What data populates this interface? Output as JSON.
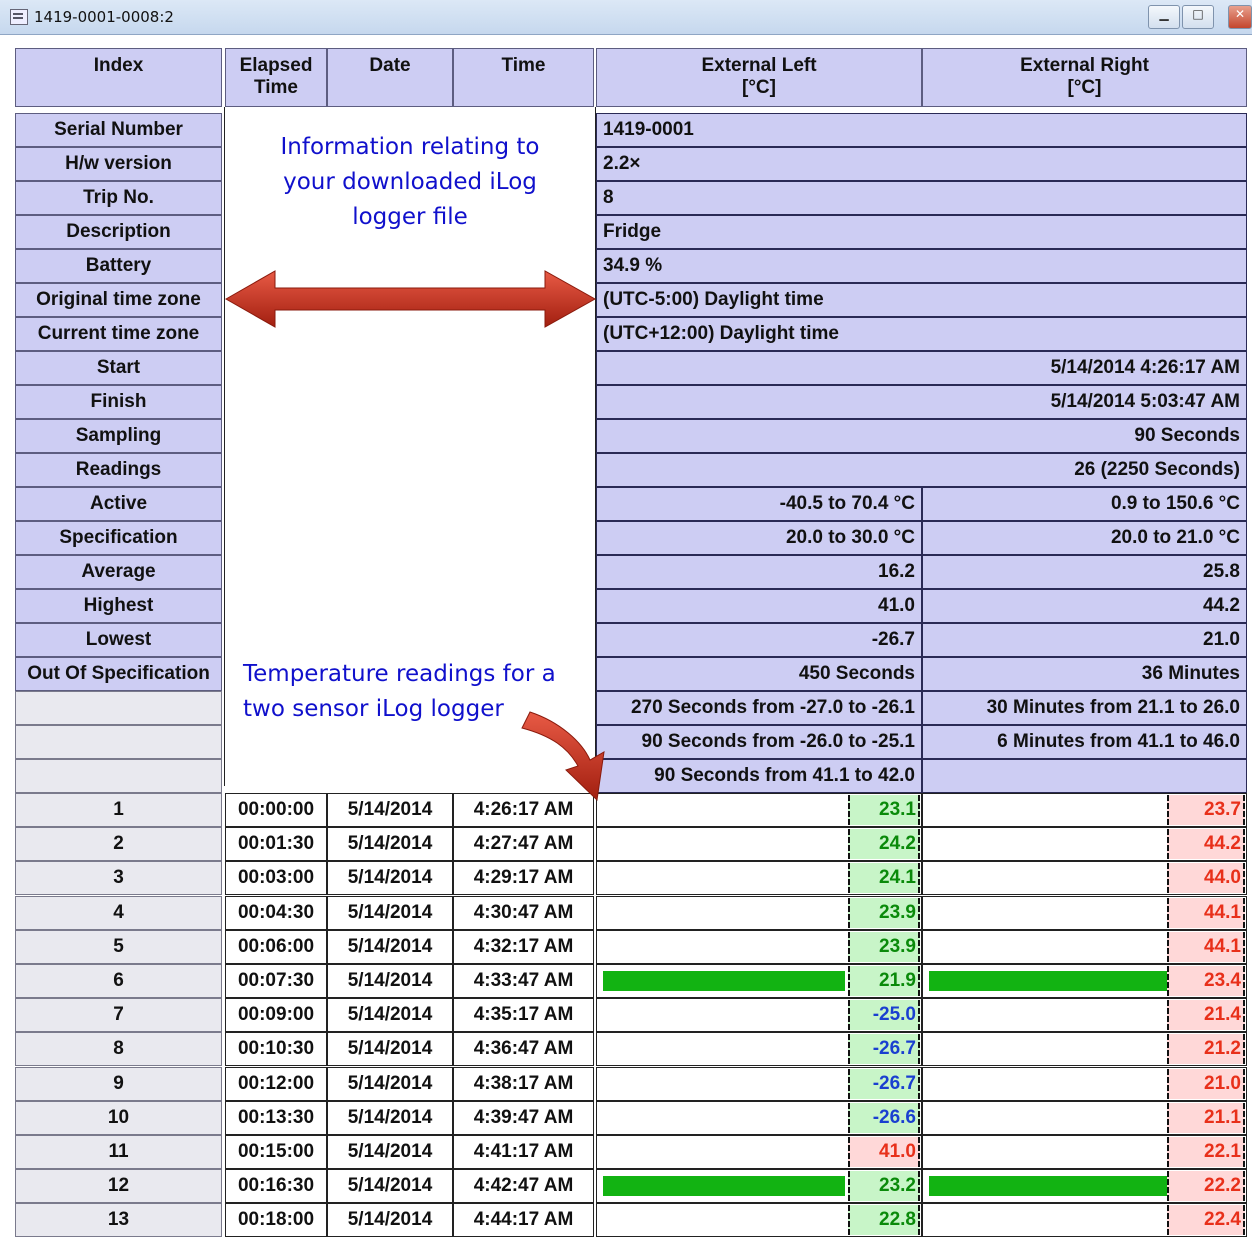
{
  "window": {
    "title": "1419-0001-0008:2"
  },
  "colors": {
    "header_bg": "#cdcdf3",
    "ok_green": "#12b312",
    "cell_green": "#c8f5c8",
    "cell_red": "#ffd8d8",
    "text_red": "#e8301a",
    "text_blue": "#1a3fd0",
    "text_green": "#0a8a0a",
    "note_blue": "#1010cc",
    "arrow_red": "#c8301d"
  },
  "headers": {
    "index": "Index",
    "elapsed_l1": "Elapsed",
    "elapsed_l2": "Time",
    "date": "Date",
    "time": "Time",
    "ext_left_l1": "External Left",
    "ext_left_l2": "[°C]",
    "ext_right_l1": "External Right",
    "ext_right_l2": "[°C]"
  },
  "info": {
    "serial": {
      "label": "Serial Number",
      "value": "1419-0001"
    },
    "hw": {
      "label": "H/w version",
      "value": "2.2×"
    },
    "trip": {
      "label": "Trip No.",
      "value": "8"
    },
    "description": {
      "label": "Description",
      "value": "Fridge"
    },
    "battery": {
      "label": "Battery",
      "value": "34.9 %"
    },
    "orig_tz": {
      "label": "Original time zone",
      "value": "(UTC-5:00) Daylight time"
    },
    "cur_tz": {
      "label": "Current time zone",
      "value": "(UTC+12:00) Daylight time"
    },
    "start": {
      "label": "Start",
      "value": "5/14/2014  4:26:17 AM"
    },
    "finish": {
      "label": "Finish",
      "value": "5/14/2014  5:03:47 AM"
    },
    "sampling": {
      "label": "Sampling",
      "value": "90 Seconds"
    },
    "readings": {
      "label": "Readings",
      "value": "26 (2250 Seconds)"
    },
    "active": {
      "label": "Active",
      "left": "-40.5 to 70.4 °C",
      "right": "0.9 to 150.6 °C"
    },
    "spec": {
      "label": "Specification",
      "left": "20.0 to 30.0 °C",
      "right": "20.0 to 21.0 °C"
    },
    "average": {
      "label": "Average",
      "left": "16.2",
      "right": "25.8"
    },
    "highest": {
      "label": "Highest",
      "left": "41.0",
      "right": "44.2"
    },
    "lowest": {
      "label": "Lowest",
      "left": "-26.7",
      "right": "21.0"
    },
    "oos": {
      "label": "Out Of Specification",
      "left": "450 Seconds",
      "right": "36 Minutes"
    },
    "oos1": {
      "left": "270 Seconds from -27.0 to -26.1",
      "right": "30 Minutes from 21.1 to 26.0"
    },
    "oos2": {
      "left": "90 Seconds from -26.0 to -25.1",
      "right": "6 Minutes from 41.1 to 46.0"
    },
    "oos3": {
      "left": "90 Seconds from 41.1 to 42.0"
    }
  },
  "notes": {
    "info": [
      "Information relating to",
      "your downloaded iLog",
      "logger file"
    ],
    "temp": [
      "Temperature readings for a",
      "two sensor iLog logger"
    ]
  },
  "readings": [
    {
      "index": "1",
      "elapsed": "00:00:00",
      "date": "5/14/2014",
      "time": "4:26:17 AM",
      "left": "23.1",
      "left_status": "ok",
      "right": "23.7",
      "right_status": "high",
      "bar_fraction": 0
    },
    {
      "index": "2",
      "elapsed": "00:01:30",
      "date": "5/14/2014",
      "time": "4:27:47 AM",
      "left": "24.2",
      "left_status": "ok",
      "right": "44.2",
      "right_status": "high",
      "bar_fraction": 0
    },
    {
      "index": "3",
      "elapsed": "00:03:00",
      "date": "5/14/2014",
      "time": "4:29:17 AM",
      "left": "24.1",
      "left_status": "ok",
      "right": "44.0",
      "right_status": "high",
      "bar_fraction": 0
    },
    {
      "index": "4",
      "elapsed": "00:04:30",
      "date": "5/14/2014",
      "time": "4:30:47 AM",
      "left": "23.9",
      "left_status": "ok",
      "right": "44.1",
      "right_status": "high",
      "bar_fraction": 0
    },
    {
      "index": "5",
      "elapsed": "00:06:00",
      "date": "5/14/2014",
      "time": "4:32:17 AM",
      "left": "23.9",
      "left_status": "ok",
      "right": "44.1",
      "right_status": "high",
      "bar_fraction": 0
    },
    {
      "index": "6",
      "elapsed": "00:07:30",
      "date": "5/14/2014",
      "time": "4:33:47 AM",
      "left": "21.9",
      "left_status": "ok",
      "right": "23.4",
      "right_status": "high",
      "bar_fraction": 1
    },
    {
      "index": "7",
      "elapsed": "00:09:00",
      "date": "5/14/2014",
      "time": "4:35:17 AM",
      "left": "-25.0",
      "left_status": "low",
      "right": "21.4",
      "right_status": "high",
      "bar_fraction": 0
    },
    {
      "index": "8",
      "elapsed": "00:10:30",
      "date": "5/14/2014",
      "time": "4:36:47 AM",
      "left": "-26.7",
      "left_status": "low",
      "right": "21.2",
      "right_status": "high",
      "bar_fraction": 0
    },
    {
      "index": "9",
      "elapsed": "00:12:00",
      "date": "5/14/2014",
      "time": "4:38:17 AM",
      "left": "-26.7",
      "left_status": "low",
      "right": "21.0",
      "right_status": "high",
      "bar_fraction": 0
    },
    {
      "index": "10",
      "elapsed": "00:13:30",
      "date": "5/14/2014",
      "time": "4:39:47 AM",
      "left": "-26.6",
      "left_status": "low",
      "right": "21.1",
      "right_status": "high",
      "bar_fraction": 0
    },
    {
      "index": "11",
      "elapsed": "00:15:00",
      "date": "5/14/2014",
      "time": "4:41:17 AM",
      "left": "41.0",
      "left_status": "high",
      "right": "22.1",
      "right_status": "high",
      "bar_fraction": 0
    },
    {
      "index": "12",
      "elapsed": "00:16:30",
      "date": "5/14/2014",
      "time": "4:42:47 AM",
      "left": "23.2",
      "left_status": "ok",
      "right": "22.2",
      "right_status": "high",
      "bar_fraction": 1
    },
    {
      "index": "13",
      "elapsed": "00:18:00",
      "date": "5/14/2014",
      "time": "4:44:17 AM",
      "left": "22.8",
      "left_status": "ok",
      "right": "22.4",
      "right_status": "high",
      "bar_fraction": 0
    }
  ]
}
